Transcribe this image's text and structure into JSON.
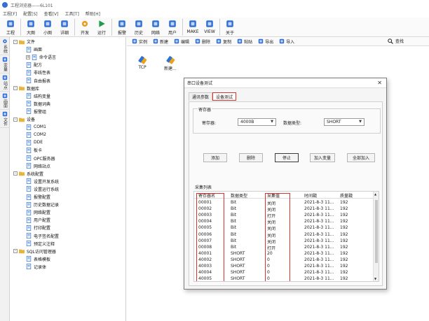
{
  "window": {
    "title": "工程浏览器——6L101"
  },
  "menu": [
    "工程[F]",
    "配置[S]",
    "查看[V]",
    "工具[T]",
    "帮助[H]"
  ],
  "toolbar": [
    {
      "label": "工程",
      "icon": "wrench-icon",
      "color": "#2f6fd6"
    },
    {
      "label": "大图",
      "icon": "large-icons-icon",
      "color": "#2f6fd6"
    },
    {
      "label": "小图",
      "icon": "small-icons-icon",
      "color": "#2f6fd6"
    },
    {
      "label": "详细",
      "icon": "details-icon",
      "color": "#2f6fd6"
    },
    {
      "label": "开发",
      "icon": "gear-icon",
      "color": "#e89a1d"
    },
    {
      "label": "运行",
      "icon": "run-icon",
      "color": "#1f9c4f"
    },
    {
      "label": "报警",
      "icon": "alarm-icon",
      "color": "#2f6fd6"
    },
    {
      "label": "历史",
      "icon": "history-icon",
      "color": "#2f6fd6"
    },
    {
      "label": "网络",
      "icon": "network-icon",
      "color": "#2f6fd6"
    },
    {
      "label": "用户",
      "icon": "user-icon",
      "color": "#2f6fd6"
    },
    {
      "label": "MAKE",
      "icon": "make-icon",
      "color": "#2f6fd6"
    },
    {
      "label": "VIEW",
      "icon": "view-icon",
      "color": "#2f6fd6"
    },
    {
      "label": "关于",
      "icon": "about-icon",
      "color": "#2f6fd6"
    }
  ],
  "left_strip": [
    "系统",
    "变量",
    "站点",
    "画面",
    "文件"
  ],
  "tree": [
    {
      "label": "文件",
      "level": 0,
      "expander": "-",
      "icon": "folder-icon"
    },
    {
      "label": "画面",
      "level": 1,
      "expander": "",
      "icon": "screen-icon"
    },
    {
      "label": "命令语言",
      "level": 1,
      "expander": "+",
      "icon": "script-icon"
    },
    {
      "label": "配方",
      "level": 1,
      "expander": "",
      "icon": "recipe-icon"
    },
    {
      "label": "非线性表",
      "level": 1,
      "expander": "",
      "icon": "table-icon"
    },
    {
      "label": "自由报表",
      "level": 1,
      "expander": "",
      "icon": "report-icon"
    },
    {
      "label": "数据库",
      "level": 0,
      "expander": "-",
      "icon": "database-icon"
    },
    {
      "label": "结构变量",
      "level": 1,
      "expander": "",
      "icon": "struct-icon"
    },
    {
      "label": "数据词典",
      "level": 1,
      "expander": "",
      "icon": "dictionary-icon"
    },
    {
      "label": "报警组",
      "level": 1,
      "expander": "",
      "icon": "alarm-group-icon"
    },
    {
      "label": "设备",
      "level": 0,
      "expander": "-",
      "icon": "device-icon"
    },
    {
      "label": "COM1",
      "level": 1,
      "expander": "",
      "icon": "port-icon"
    },
    {
      "label": "COM2",
      "level": 1,
      "expander": "",
      "icon": "port-icon"
    },
    {
      "label": "DDE",
      "level": 1,
      "expander": "",
      "icon": "dde-icon"
    },
    {
      "label": "板卡",
      "level": 1,
      "expander": "",
      "icon": "card-icon"
    },
    {
      "label": "OPC服务器",
      "level": 1,
      "expander": "",
      "icon": "opc-icon"
    },
    {
      "label": "网络站点",
      "level": 1,
      "expander": "",
      "icon": "network-node-icon"
    },
    {
      "label": "系统配置",
      "level": 0,
      "expander": "-",
      "icon": "config-icon"
    },
    {
      "label": "设置开发系统",
      "level": 1,
      "expander": "",
      "icon": "dev-settings-icon"
    },
    {
      "label": "设置运行系统",
      "level": 1,
      "expander": "",
      "icon": "run-settings-icon"
    },
    {
      "label": "报警配置",
      "level": 1,
      "expander": "",
      "icon": "alarm-config-icon"
    },
    {
      "label": "历史数据记录",
      "level": 1,
      "expander": "",
      "icon": "history-record-icon"
    },
    {
      "label": "网络配置",
      "level": 1,
      "expander": "",
      "icon": "network-config-icon"
    },
    {
      "label": "用户配置",
      "level": 1,
      "expander": "",
      "icon": "user-config-icon"
    },
    {
      "label": "打印配置",
      "level": 1,
      "expander": "",
      "icon": "print-icon"
    },
    {
      "label": "电子签名配置",
      "level": 1,
      "expander": "",
      "icon": "signature-icon"
    },
    {
      "label": "预定义注释",
      "level": 1,
      "expander": "",
      "icon": "note-icon"
    },
    {
      "label": "SQL访问管理器",
      "level": 0,
      "expander": "-",
      "icon": "sql-icon"
    },
    {
      "label": "表格模板",
      "level": 1,
      "expander": "",
      "icon": "template-icon"
    },
    {
      "label": "记录体",
      "level": 1,
      "expander": "",
      "icon": "record-icon"
    }
  ],
  "right_toolbar": [
    {
      "label": "实例",
      "icon": "instance-icon"
    },
    {
      "label": "新建",
      "icon": "new-icon"
    },
    {
      "label": "编辑",
      "icon": "edit-icon"
    },
    {
      "label": "删除",
      "icon": "delete-icon"
    },
    {
      "label": "复制",
      "icon": "copy-icon"
    },
    {
      "label": "粘贴",
      "icon": "paste-icon"
    },
    {
      "label": "导出",
      "icon": "export-icon"
    },
    {
      "label": "导入",
      "icon": "import-icon"
    }
  ],
  "search_label": "查找",
  "canvas_items": [
    {
      "label": "TCP",
      "icon": "tcp-device-icon"
    },
    {
      "label": "新建...",
      "icon": "new-device-icon"
    }
  ],
  "dialog": {
    "title": "串口设备测试",
    "close": "✕",
    "tabs": [
      "通讯参数",
      "设备测试"
    ],
    "active_tab": 1,
    "group_title": "寄存器",
    "register_label": "寄存器:",
    "register_value": "4000B",
    "datatype_label": "数据类型:",
    "datatype_value": "SHORT",
    "buttons": [
      "添加",
      "删除",
      "停止",
      "加入变量",
      "全部加入"
    ],
    "list_label": "采集列表",
    "columns": [
      "寄存器名",
      "数据类型",
      "采集值",
      "时间戳",
      "质量戳"
    ],
    "rows": [
      [
        "00001",
        "Bit",
        "关闭",
        "2021-8-3 11...",
        "192"
      ],
      [
        "00002",
        "Bit",
        "关闭",
        "2021-8-3 11...",
        "192"
      ],
      [
        "00003",
        "Bit",
        "打开",
        "2021-8-3 11...",
        "192"
      ],
      [
        "00004",
        "Bit",
        "关闭",
        "2021-8-3 11...",
        "192"
      ],
      [
        "00005",
        "Bit",
        "关闭",
        "2021-8-3 11...",
        "192"
      ],
      [
        "00006",
        "Bit",
        "关闭",
        "2021-8-3 11...",
        "192"
      ],
      [
        "00007",
        "Bit",
        "关闭",
        "2021-8-3 11...",
        "192"
      ],
      [
        "00008",
        "Bit",
        "打开",
        "2021-8-3 11...",
        "192"
      ],
      [
        "40001",
        "SHORT",
        "20",
        "2021-8-3 11...",
        "192"
      ],
      [
        "40002",
        "SHORT",
        "0",
        "2021-8-3 11...",
        "192"
      ],
      [
        "40003",
        "SHORT",
        "0",
        "2021-8-3 11...",
        "192"
      ],
      [
        "40004",
        "SHORT",
        "0",
        "2021-8-3 11...",
        "192"
      ],
      [
        "40005",
        "SHORT",
        "0",
        "2021-8-3 11...",
        "192"
      ]
    ],
    "highlight_color": "#d9322f"
  }
}
